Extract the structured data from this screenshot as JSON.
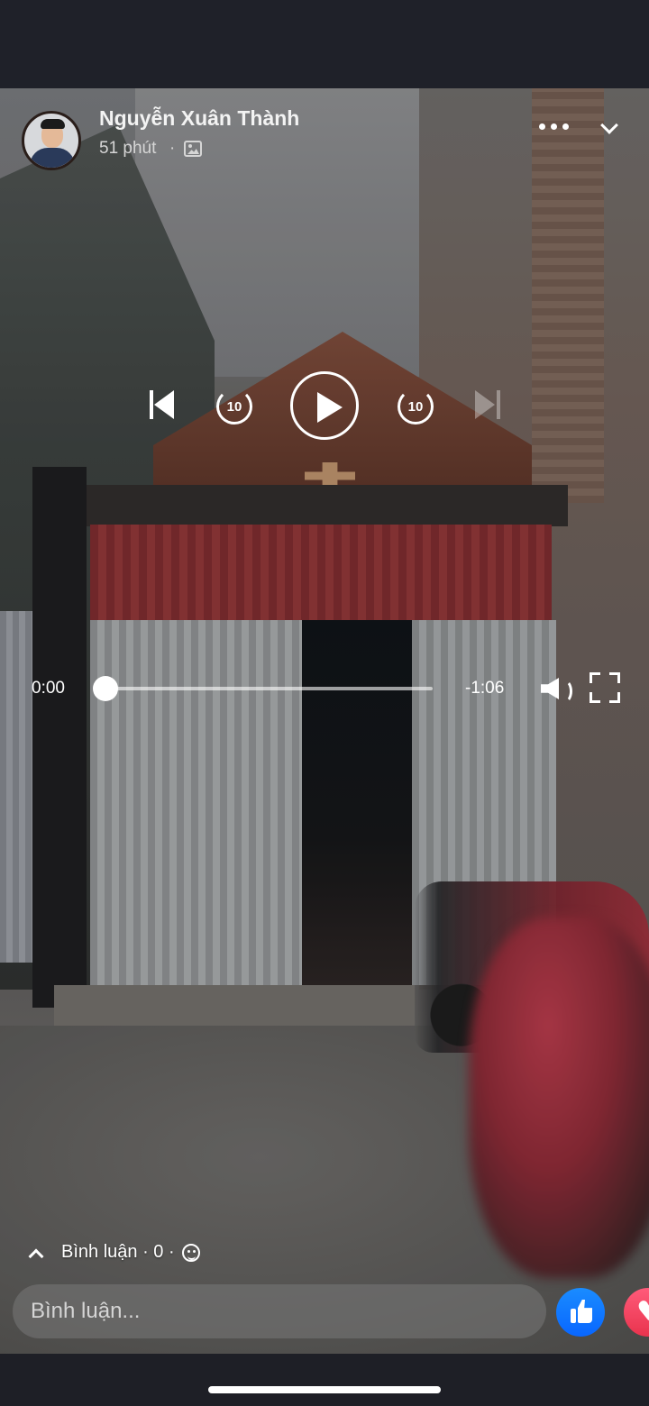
{
  "post": {
    "author_name": "Nguyễn Xuân Thành",
    "time": "51 phút",
    "separator": "·",
    "audience_icon": "photo-album-icon"
  },
  "player": {
    "skip_back_label": "10",
    "skip_forward_label": "10",
    "current_time": "0:00",
    "remaining_time": "-1:06",
    "progress": 0,
    "state": "paused"
  },
  "comments": {
    "label": "Bình luận · 0 ·",
    "input_placeholder": "Bình luận..."
  },
  "colors": {
    "status_bar": "#1f2129",
    "like_blue": "#0866ff",
    "love_red": "#e9334d"
  }
}
